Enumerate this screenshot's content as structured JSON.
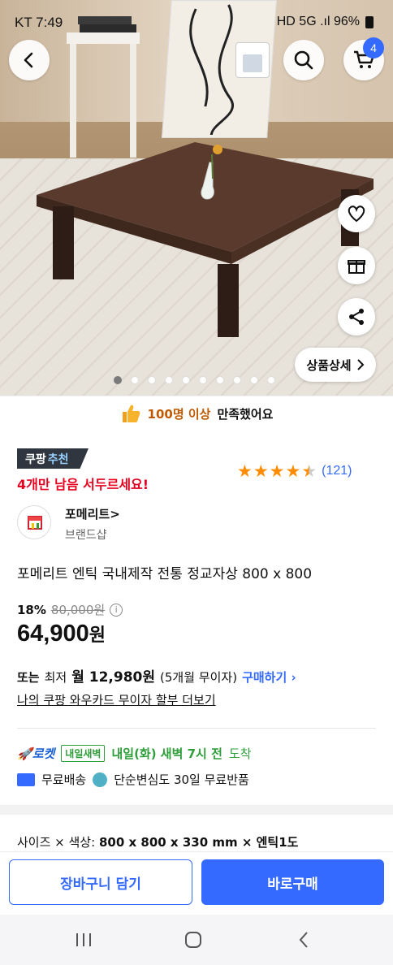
{
  "status_bar": {
    "time": "KT 7:49",
    "indicators": "HD 5G .ıl 96%"
  },
  "header": {
    "cart_count": "4",
    "icons": [
      "back-icon",
      "search-icon",
      "cart-icon"
    ]
  },
  "gallery": {
    "image_count": 10,
    "active_index": 0,
    "detail_button": "상품상세",
    "side_actions": [
      "heart-icon",
      "gift-icon",
      "share-icon"
    ]
  },
  "satisfaction": {
    "highlight": "100명 이상",
    "text": "만족했어요"
  },
  "badge": {
    "part1": "쿠팡",
    "part2": "추천"
  },
  "stock_alert": "4개만 남음 서두르세요!",
  "rating": {
    "stars": 4.5,
    "count": "(121)"
  },
  "brand": {
    "name": "포메리트",
    "chevron": ">",
    "subtitle": "브랜드샵"
  },
  "product": {
    "title": "포메리트 엔틱 국내제작 전통 정교자상 800 x 800"
  },
  "price": {
    "discount": "18%",
    "original": "80,000원",
    "current": "64,900",
    "currency": "원"
  },
  "installment": {
    "prefix": "또는",
    "min_label": "최저",
    "monthly": "월 12,980원",
    "terms": "(5개월 무이자)",
    "buy_link": "구매하기",
    "wow_link": "나의 쿠팡 와우카드 무이자 할부 더보기"
  },
  "delivery": {
    "rocket": "로켓",
    "tag": "내일새벽",
    "schedule": "내일(화) 새벽 7시 전",
    "arrive": "도착",
    "shipping": "무료배송",
    "returns": "단순변심도 30일 무료반품"
  },
  "option": {
    "label": "사이즈 × 색상:",
    "value": "800 x 800 x 330 mm × 엔틱1도"
  },
  "actions": {
    "add_to_cart": "장바구니 담기",
    "buy_now": "바로구매"
  },
  "colors": {
    "accent": "#346aff",
    "alert": "#e6001f",
    "rocket_green": "#2e9e3a",
    "star": "#ff8c00"
  }
}
